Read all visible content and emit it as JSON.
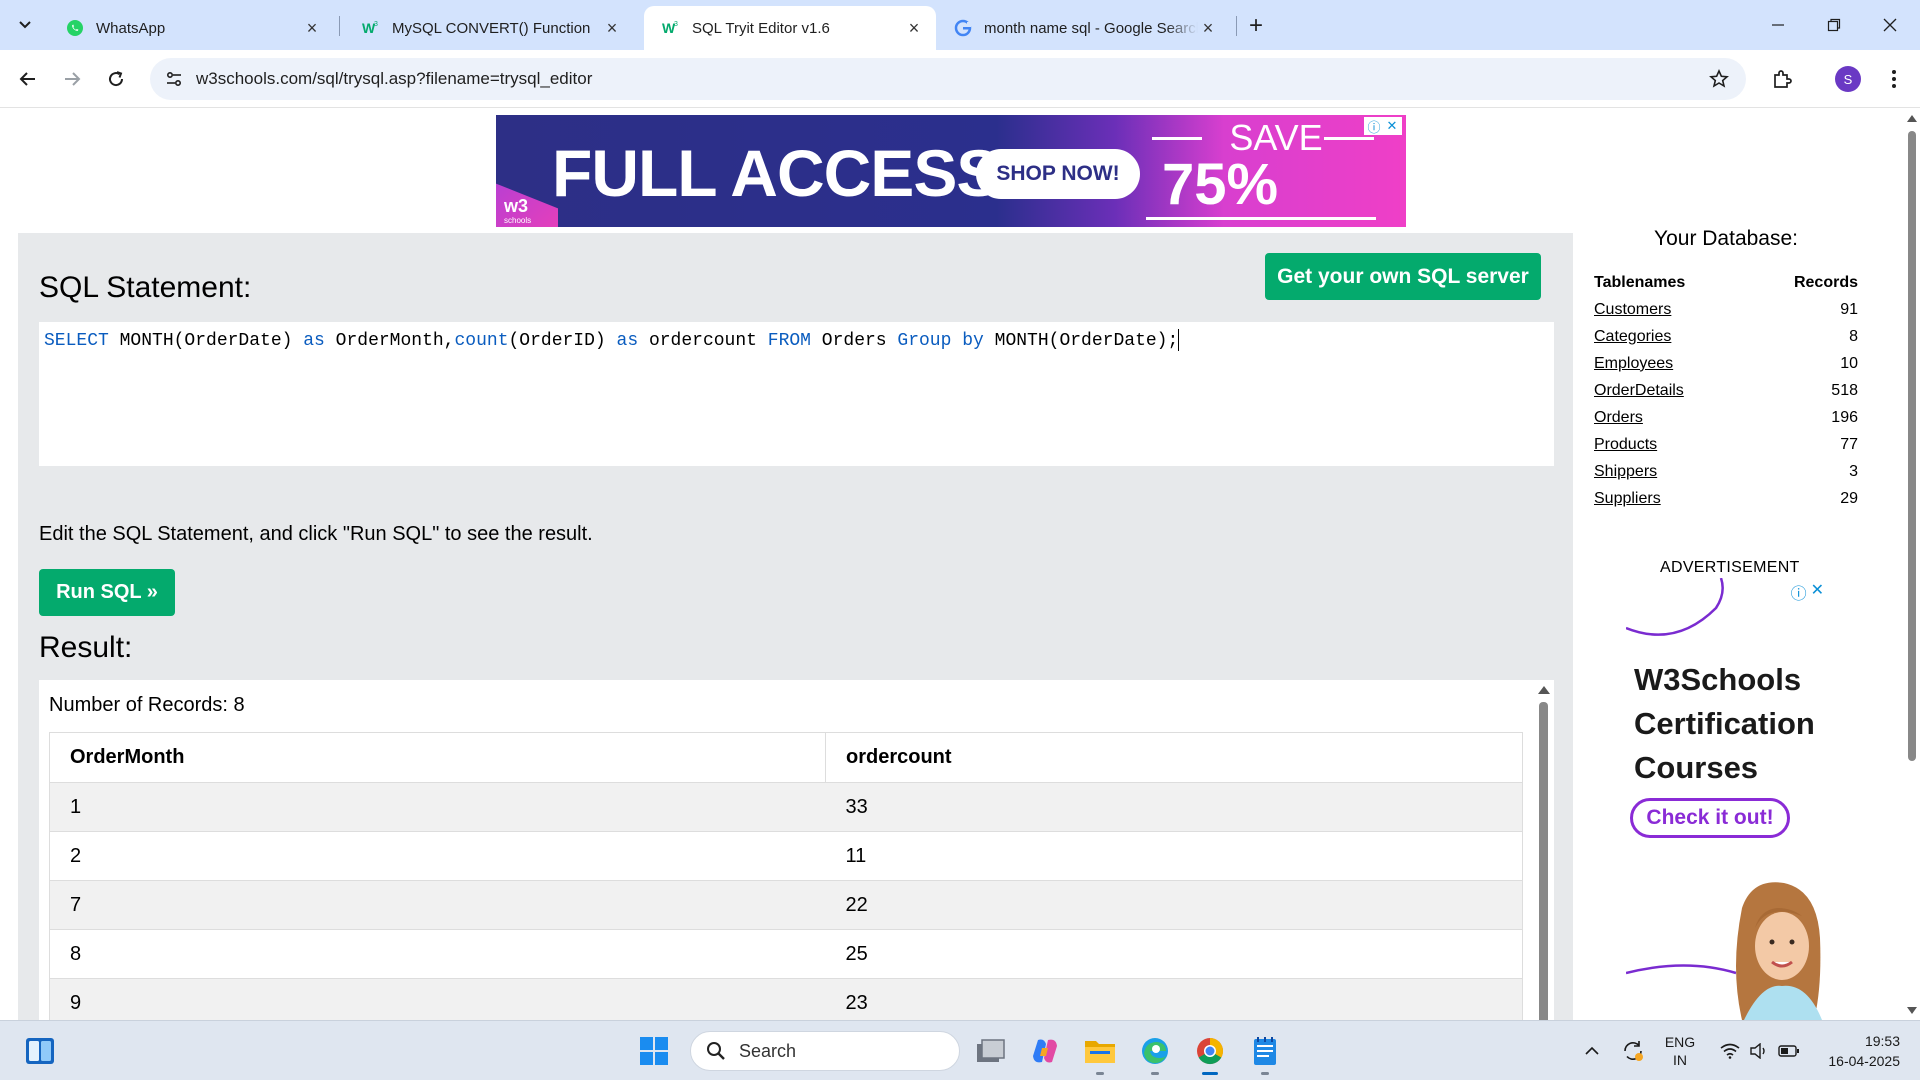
{
  "browser": {
    "tabs": [
      {
        "title": "WhatsApp",
        "favicon": "whatsapp-icon",
        "active": false
      },
      {
        "title": "MySQL CONVERT() Function",
        "favicon": "w3schools-icon",
        "active": false
      },
      {
        "title": "SQL Tryit Editor v1.6",
        "favicon": "w3schools-icon",
        "active": true
      },
      {
        "title": "month name sql - Google Search",
        "favicon": "google-icon",
        "active": false
      }
    ],
    "url": "w3schools.com/sql/trysql.asp?filename=trysql_editor",
    "profile_initial": "S"
  },
  "banner_ad": {
    "headline": "FULL ACCESS",
    "cta": "SHOP NOW!",
    "save_label": "SAVE",
    "discount": "75% OFF",
    "logo": "w3",
    "logo_sub": "schools"
  },
  "editor": {
    "heading": "SQL Statement:",
    "own_server_button": "Get your own SQL server",
    "sql_tokens": [
      {
        "t": "SELECT",
        "kw": true
      },
      {
        "t": " MONTH(OrderDate) ",
        "kw": false
      },
      {
        "t": "as",
        "kw": true
      },
      {
        "t": " OrderMonth,",
        "kw": false
      },
      {
        "t": "count",
        "kw": true
      },
      {
        "t": "(OrderID) ",
        "kw": false
      },
      {
        "t": "as",
        "kw": true
      },
      {
        "t": " ordercount ",
        "kw": false
      },
      {
        "t": "FROM",
        "kw": true
      },
      {
        "t": " Orders ",
        "kw": false
      },
      {
        "t": "Group",
        "kw": true
      },
      {
        "t": " ",
        "kw": false
      },
      {
        "t": "by",
        "kw": true
      },
      {
        "t": " MONTH(OrderDate);",
        "kw": false
      }
    ],
    "instruction": "Edit the SQL Statement, and click \"Run SQL\" to see the result.",
    "run_button": "Run SQL »",
    "result_heading": "Result:"
  },
  "result": {
    "record_count_text": "Number of Records: 8",
    "columns": [
      "OrderMonth",
      "ordercount"
    ],
    "rows": [
      [
        "1",
        "33"
      ],
      [
        "2",
        "11"
      ],
      [
        "7",
        "22"
      ],
      [
        "8",
        "25"
      ],
      [
        "9",
        "23"
      ]
    ]
  },
  "database": {
    "title": "Your Database:",
    "col_names": "Tablenames",
    "col_records": "Records",
    "tables": [
      {
        "name": "Customers",
        "records": "91"
      },
      {
        "name": "Categories",
        "records": "8"
      },
      {
        "name": "Employees",
        "records": "10"
      },
      {
        "name": "OrderDetails",
        "records": "518"
      },
      {
        "name": "Orders",
        "records": "196"
      },
      {
        "name": "Products",
        "records": "77"
      },
      {
        "name": "Shippers",
        "records": "3"
      },
      {
        "name": "Suppliers",
        "records": "29"
      }
    ]
  },
  "side_ad": {
    "label": "ADVERTISEMENT",
    "title_lines": [
      "W3Schools",
      "Certification",
      "Courses"
    ],
    "cta": "Check it out!"
  },
  "taskbar": {
    "search_placeholder": "Search",
    "lang_top": "ENG",
    "lang_bottom": "IN",
    "time": "19:53",
    "date": "16-04-2025"
  },
  "colors": {
    "w3_green": "#04aa6d",
    "sql_keyword": "#0a5cbf",
    "panel_bg": "#e7e9eb",
    "tabstrip_bg": "#d3e3fd"
  }
}
